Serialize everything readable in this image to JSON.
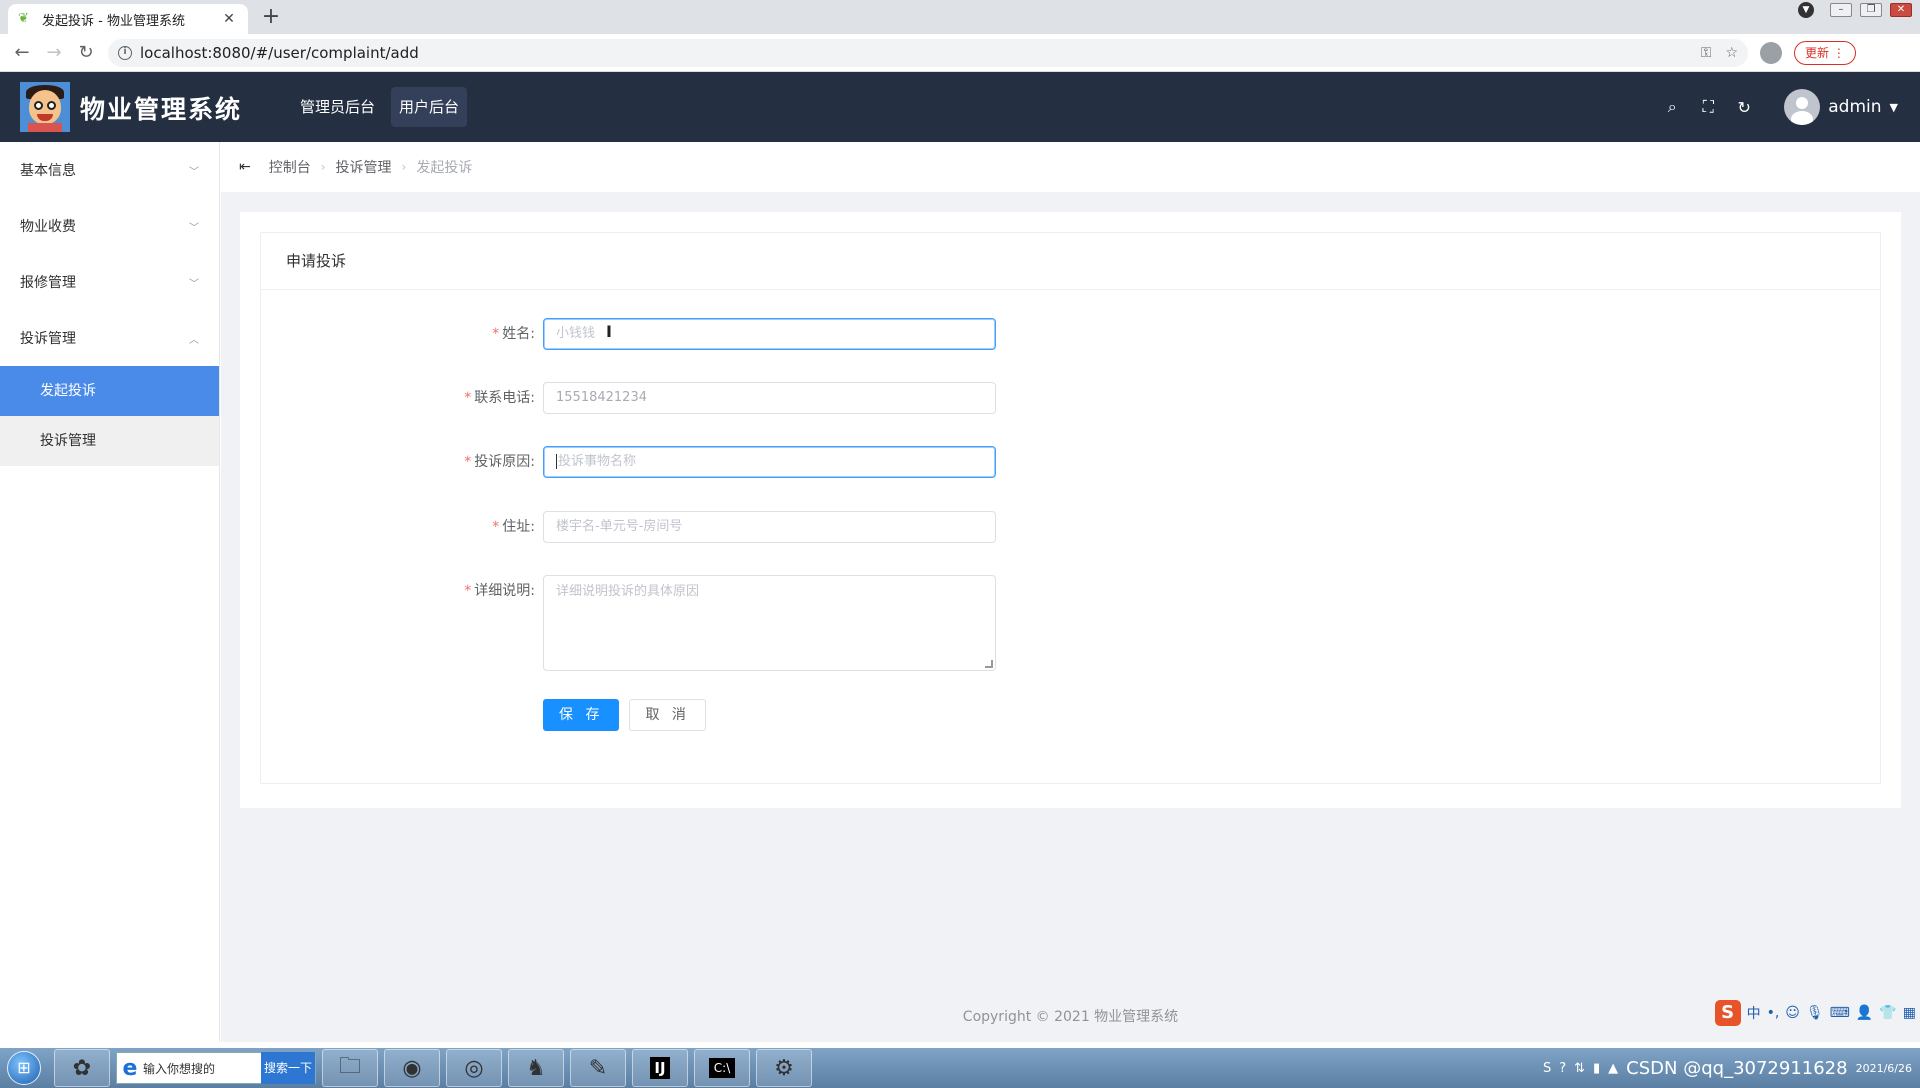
{
  "browser": {
    "tab_title": "发起投诉 - 物业管理系统",
    "tab_close": "✕",
    "new_tab": "+",
    "url": "localhost:8080/#/user/complaint/add",
    "update_label": "更新"
  },
  "header": {
    "app_title": "物业管理系统",
    "nav": [
      {
        "label": "管理员后台",
        "active": false
      },
      {
        "label": "用户后台",
        "active": true
      }
    ],
    "username": "admin"
  },
  "sidebar": {
    "groups": [
      {
        "label": "基本信息",
        "expanded": false
      },
      {
        "label": "物业收费",
        "expanded": false
      },
      {
        "label": "报修管理",
        "expanded": false
      },
      {
        "label": "投诉管理",
        "expanded": true
      }
    ],
    "subitems": [
      {
        "label": "发起投诉",
        "active": true
      },
      {
        "label": "投诉管理",
        "active": false
      }
    ]
  },
  "breadcrumb": [
    "控制台",
    "投诉管理",
    "发起投诉"
  ],
  "form": {
    "panel_title": "申请投诉",
    "fields": [
      {
        "label": "姓名:",
        "value": "",
        "placeholder": "小钱钱"
      },
      {
        "label": "联系电话:",
        "value": "",
        "placeholder": "15518421234"
      },
      {
        "label": "投诉原因:",
        "value": "",
        "placeholder": "投诉事物名称"
      },
      {
        "label": "住址:",
        "value": "",
        "placeholder": "楼宇名-单元号-房间号"
      },
      {
        "label": "详细说明:",
        "value": "",
        "placeholder": "详细说明投诉的具体原因"
      }
    ],
    "save_label": "保 存",
    "cancel_label": "取 消"
  },
  "footer": {
    "copyright": "Copyright © 2021 物业管理系统"
  },
  "taskbar": {
    "search_text": "输入你想搜的",
    "search_button": "搜索一下",
    "watermark": "CSDN @qq_3072911628",
    "date": "2021/6/26"
  },
  "colors": {
    "header_bg": "#242f42",
    "accent": "#409eff",
    "sidebar_active": "#4a8ae8",
    "primary_button": "#1890ff",
    "required": "#f56c6c"
  }
}
